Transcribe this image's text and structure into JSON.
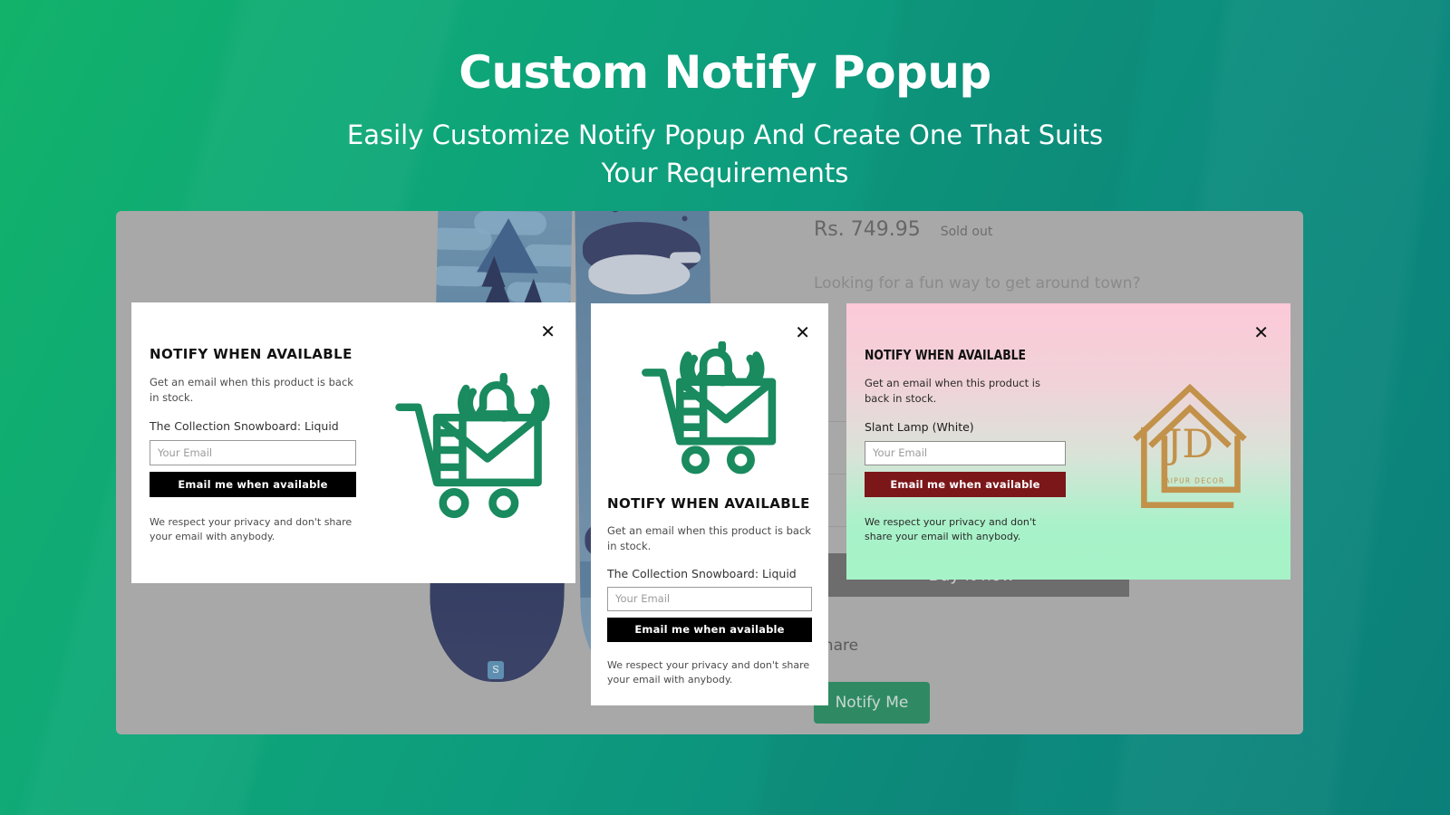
{
  "hero": {
    "title": "Custom Notify Popup",
    "subtitle": "Easily Customize Notify Popup And Create One That Suits Your Requirements"
  },
  "colors": {
    "bg_green_left": "#12b26a",
    "bg_teal_right": "#0b7f79",
    "panel_gray": "#a8a8a8",
    "icon_green": "#1a8a5f",
    "btn_black": "#000000",
    "btn_darkred": "#7b1619",
    "notify_me_green": "#2f8a63",
    "popup3_gradient_top": "#fcc9d8",
    "popup3_gradient_bottom": "#a6f3c8",
    "logo_gold": "#c2914a"
  },
  "store": {
    "price": "Rs. 749.95",
    "stock_status": "Sold out",
    "description_line1": "Looking for a fun way to get around town?",
    "buy_it_now_label": "Buy it now",
    "share_label": "Share",
    "notify_me_label": "Notify Me",
    "shop_badge": "S"
  },
  "popups": [
    {
      "id": "popup-1",
      "layout": "horizontal",
      "title": "NOTIFY WHEN AVAILABLE",
      "subtitle": "Get an email when this product is back in stock.",
      "product_name": "The Collection Snowboard: Liquid",
      "email_placeholder": "Your Email",
      "email_value": "",
      "submit_label": "Email me when available",
      "privacy_note": "We respect your privacy and don't share your email with anybody.",
      "close_label": "✕",
      "artwork": "cart-envelope-bell-icon",
      "button_color": "#000000"
    },
    {
      "id": "popup-2",
      "layout": "vertical",
      "title": "NOTIFY WHEN AVAILABLE",
      "subtitle": "Get an email when this product is back in stock.",
      "product_name": "The Collection Snowboard: Liquid",
      "email_placeholder": "Your Email",
      "email_value": "",
      "submit_label": "Email me when available",
      "privacy_note": "We respect your privacy and don't share your email with anybody.",
      "close_label": "✕",
      "artwork": "cart-envelope-bell-icon",
      "button_color": "#000000"
    },
    {
      "id": "popup-3",
      "layout": "horizontal-gradient",
      "title": "NOTIFY WHEN AVAILABLE",
      "subtitle": "Get an email when this product is back in stock.",
      "product_name": "Slant Lamp (White)",
      "email_placeholder": "Your Email",
      "email_value": "",
      "submit_label": "Email me when available",
      "privacy_note": "We respect your privacy and don't share your email with anybody.",
      "close_label": "✕",
      "artwork": "jaipur-decor-house-logo",
      "button_color": "#7b1619",
      "logo_initials": "JD",
      "logo_caption": "JAIPUR DECOR"
    }
  ]
}
